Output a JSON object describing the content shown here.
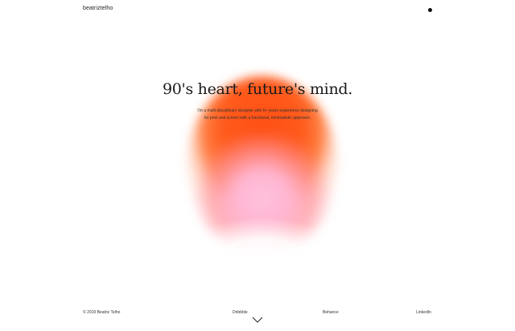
{
  "header": {
    "brand": "beatriztelho",
    "menu_icon": "menu-dot-icon"
  },
  "hero": {
    "headline": "90's heart, future's mind.",
    "intro_line1": "I'm a multi-disciplinary designer with 6+ years experience designing",
    "intro_line2": "for print and screen with a functional, minimalistic approach."
  },
  "footer": {
    "copyright": "© 2019 Beatriz Telho",
    "links": [
      {
        "label": "Dribbble"
      },
      {
        "label": "Behance"
      },
      {
        "label": "LinkedIn"
      }
    ],
    "scroll_icon": "chevron-down-icon"
  },
  "colors": {
    "orb_orange": "#ff4f14",
    "orb_pink": "#ffb6d2",
    "background": "#ffffff",
    "text": "#1a1a1a"
  }
}
